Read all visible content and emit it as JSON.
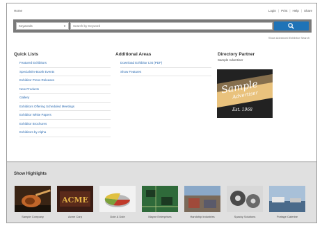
{
  "topbar": {
    "home": "Home",
    "links": [
      "Login",
      "Print",
      "Help",
      "Share"
    ]
  },
  "search": {
    "select_value": "Keywords",
    "placeholder": "Search by Keyword",
    "button_icon": "search-icon",
    "advanced_link": "Show Advanced Exhibitor Search"
  },
  "quick_lists": {
    "title": "Quick Lists",
    "items": [
      "Featured Exhibitors",
      "Specials/In-Booth Events",
      "Exhibitor Press Releases",
      "New Products",
      "Gallery",
      "Exhibitors Offering Scheduled Meetings",
      "Exhibitor White Papers",
      "Exhibitor Brochures",
      "Exhibitors by Alpha"
    ]
  },
  "additional_areas": {
    "title": "Additional Areas",
    "items": [
      "Download Exhibitor List (PDF)",
      "Show Features"
    ]
  },
  "directory_partner": {
    "title": "Directory Partner",
    "subtitle": "Sample Advertiser",
    "logo_text": [
      "Sample",
      "Advertiser",
      "Est. 1968"
    ]
  },
  "show_highlights": {
    "title": "Show Highlights",
    "items": [
      {
        "label": "Sample Company",
        "icon": "guitar-photo"
      },
      {
        "label": "Acme Corp",
        "icon": "acme-sign-photo"
      },
      {
        "label": "Dole & Dole",
        "icon": "pie-chart-photo"
      },
      {
        "label": "Mayne Enterprises",
        "icon": "circuit-board-photo"
      },
      {
        "label": "Handship Industries",
        "icon": "street-photo"
      },
      {
        "label": "Spacky Solutions",
        "icon": "gears-photo"
      },
      {
        "label": "Portage Caterine",
        "icon": "harbor-photo"
      }
    ]
  },
  "colors": {
    "link": "#2a6ab1",
    "search_bar": "#7a7a7a",
    "search_button": "#1f73b7",
    "highlights_bg": "#e0e0e0"
  }
}
